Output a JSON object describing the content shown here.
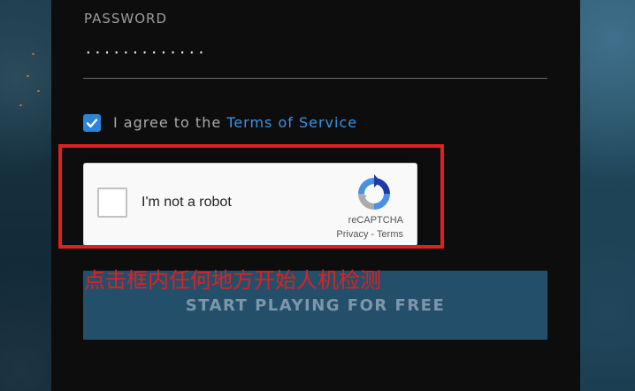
{
  "form": {
    "password_label": "PASSWORD",
    "password_value": "·············",
    "agree_checked": true,
    "agree_prefix": "I agree to the ",
    "agree_link": "Terms of Service",
    "submit_label": "START PLAYING FOR FREE"
  },
  "recaptcha": {
    "label": "I'm not a robot",
    "brand": "reCAPTCHA",
    "privacy": "Privacy",
    "separator": " - ",
    "terms": "Terms",
    "icon": "recaptcha-logo-icon"
  },
  "annotation": {
    "hint": "点击框内任何地方开始人机检测",
    "color": "#e0201f"
  },
  "colors": {
    "accent": "#2a85d8",
    "link": "#3b93e3",
    "button_bg": "#234f6b"
  }
}
